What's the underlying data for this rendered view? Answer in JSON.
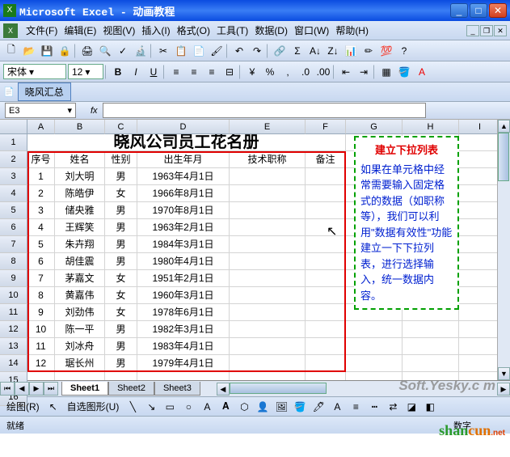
{
  "window": {
    "title": "Microsoft Excel - 动画教程"
  },
  "menu": {
    "file": "文件(F)",
    "edit": "编辑(E)",
    "view": "视图(V)",
    "insert": "插入(I)",
    "format": "格式(O)",
    "tools": "工具(T)",
    "data": "数据(D)",
    "window": "窗口(W)",
    "help": "帮助(H)"
  },
  "font": {
    "name": "宋体",
    "size": "12",
    "bold": "B",
    "italic": "I",
    "underline": "U"
  },
  "extratab": {
    "label": "晓风汇总"
  },
  "namebox": {
    "value": "E3"
  },
  "fx": {
    "label": "fx"
  },
  "columns": [
    "A",
    "B",
    "C",
    "D",
    "E",
    "F",
    "G",
    "H",
    "I"
  ],
  "rowcount": 16,
  "title_cell": "晓风公司员工花名册",
  "headers": {
    "a": "序号",
    "b": "姓名",
    "c": "性别",
    "d": "出生年月",
    "e": "技术职称",
    "f": "备注"
  },
  "employees": [
    {
      "n": "1",
      "name": "刘大明",
      "sex": "男",
      "dob": "1963年4月1日"
    },
    {
      "n": "2",
      "name": "陈皓伊",
      "sex": "女",
      "dob": "1966年8月1日"
    },
    {
      "n": "3",
      "name": "储央雅",
      "sex": "男",
      "dob": "1970年8月1日"
    },
    {
      "n": "4",
      "name": "王辉笑",
      "sex": "男",
      "dob": "1963年2月1日"
    },
    {
      "n": "5",
      "name": "朱卉翔",
      "sex": "男",
      "dob": "1984年3月1日"
    },
    {
      "n": "6",
      "name": "胡佳震",
      "sex": "男",
      "dob": "1980年4月1日"
    },
    {
      "n": "7",
      "name": "茅嘉文",
      "sex": "女",
      "dob": "1951年2月1日"
    },
    {
      "n": "8",
      "name": "黄嘉伟",
      "sex": "女",
      "dob": "1960年3月1日"
    },
    {
      "n": "9",
      "name": "刘劲伟",
      "sex": "女",
      "dob": "1978年6月1日"
    },
    {
      "n": "10",
      "name": "陈一平",
      "sex": "男",
      "dob": "1982年3月1日"
    },
    {
      "n": "11",
      "name": "刘冰舟",
      "sex": "男",
      "dob": "1983年4月1日"
    },
    {
      "n": "12",
      "name": "琚长州",
      "sex": "男",
      "dob": "1979年4月1日"
    }
  ],
  "infobox": {
    "title": "建立下拉列表",
    "body": "如果在单元格中经常需要输入固定格式的数据（如职称等），我们可以利用\"数据有效性\"功能建立一下下拉列表，进行选择输入，统一数据内容。"
  },
  "sheets": {
    "s1": "Sheet1",
    "s2": "Sheet2",
    "s3": "Sheet3"
  },
  "drawbar": {
    "draw": "绘图(R)",
    "autoshape": "自选图形(U)"
  },
  "status": {
    "left": "就绪",
    "right": "数字"
  },
  "watermark": "Soft.Yesky.c  m",
  "shancun": {
    "p1": "shan",
    "p2": "cun",
    "p3": ".net"
  }
}
